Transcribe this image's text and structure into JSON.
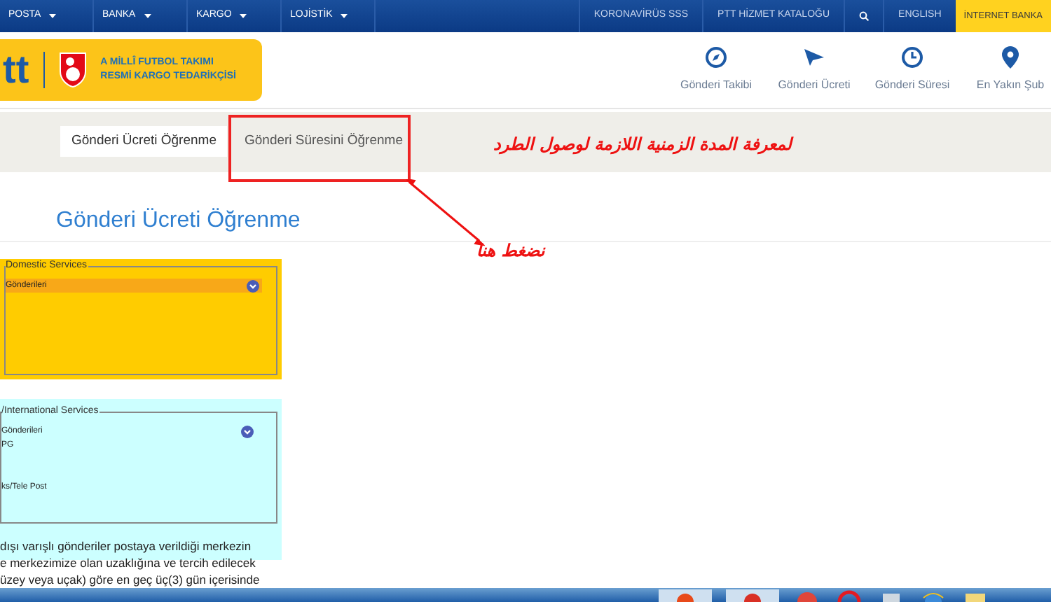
{
  "top_nav": {
    "left_items": [
      {
        "label": "POSTA"
      },
      {
        "label": "BANKA"
      },
      {
        "label": "KARGO"
      },
      {
        "label": "LOJİSTİK"
      }
    ],
    "right_items": [
      {
        "kind": "link",
        "label": "KORONAVİRÜS SSS"
      },
      {
        "kind": "link",
        "label": "PTT HİZMET KATALOĞU"
      },
      {
        "kind": "search"
      },
      {
        "kind": "link",
        "label": "ENGLISH"
      },
      {
        "kind": "highlight",
        "label": "İNTERNET BANKA"
      }
    ]
  },
  "header": {
    "logo_text": "tt",
    "sponsor_lines": [
      "A MİLLÎ FUTBOL TAKIMI",
      "RESMİ KARGO TEDARİKÇİSİ"
    ],
    "quick_links": [
      {
        "kind": "compass",
        "label": "Gönderi Takibi"
      },
      {
        "kind": "plane",
        "label": "Gönderi Ücreti"
      },
      {
        "kind": "clock",
        "label": "Gönderi Süresi"
      },
      {
        "kind": "pin",
        "label": "En Yakın Şub"
      }
    ]
  },
  "tabs": [
    {
      "label": "Gönderi Ücreti Öğrenme",
      "selected": true
    },
    {
      "label": "Gönderi Süresini Öğrenme",
      "selected": false
    }
  ],
  "annotation": {
    "caption": "لمعرفة المدة الزمنية اللازمة لوصول الطرد",
    "pointer_label": "نضغط هنا"
  },
  "page_title": "Gönderi Ücreti Öğrenme",
  "domestic": {
    "legend": "Domestic Services",
    "selected_option": "Gönderileri"
  },
  "international": {
    "legend": "/International Services",
    "options": [
      "Gönderileri",
      "PG",
      "ks/Tele Post"
    ],
    "note_lines": [
      "dışı varışlı gönderiler postaya verildiği merkezin",
      "e merkezimize olan uzaklığına ve tercih edilecek",
      "üzey veya uçak) göre en geç üç(3) gün içerisinde"
    ]
  }
}
